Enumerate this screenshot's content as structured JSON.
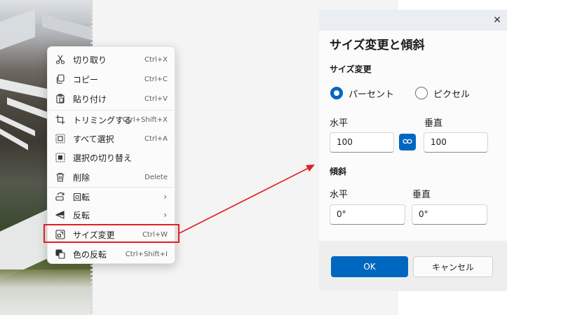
{
  "menu": {
    "items": [
      {
        "label": "切り取り",
        "shortcut": "Ctrl+X",
        "icon": "scissors-icon"
      },
      {
        "label": "コピー",
        "shortcut": "Ctrl+C",
        "icon": "copy-icon"
      },
      {
        "label": "貼り付け",
        "shortcut": "Ctrl+V",
        "icon": "paste-icon"
      },
      {
        "label": "トリミングする",
        "shortcut": "Ctrl+Shift+X",
        "icon": "crop-icon"
      },
      {
        "label": "すべて選択",
        "shortcut": "Ctrl+A",
        "icon": "select-all-icon"
      },
      {
        "label": "選択の切り替え",
        "shortcut": "",
        "icon": "invert-selection-icon"
      },
      {
        "label": "削除",
        "shortcut": "Delete",
        "icon": "trash-icon"
      },
      {
        "label": "回転",
        "shortcut": "",
        "icon": "rotate-icon",
        "submenu": "›"
      },
      {
        "label": "反転",
        "shortcut": "",
        "icon": "flip-icon",
        "submenu": "›"
      },
      {
        "label": "サイズ変更",
        "shortcut": "Ctrl+W",
        "icon": "resize-icon"
      },
      {
        "label": "色の反転",
        "shortcut": "Ctrl+Shift+I",
        "icon": "invert-colors-icon"
      }
    ]
  },
  "dialog": {
    "title": "サイズ変更と傾斜",
    "close_glyph": "✕",
    "resize": {
      "heading": "サイズ変更",
      "option_percent": "パーセント",
      "option_pixel": "ピクセル",
      "selected": "パーセント",
      "horizontal_label": "水平",
      "vertical_label": "垂直",
      "horizontal_value": "100",
      "vertical_value": "100",
      "aspect_lock": "on"
    },
    "skew": {
      "heading": "傾斜",
      "horizontal_label": "水平",
      "vertical_label": "垂直",
      "horizontal_value": "0°",
      "vertical_value": "0°"
    },
    "ok_label": "OK",
    "cancel_label": "キャンセル"
  },
  "colors": {
    "accent": "#0067c0",
    "highlight_box": "#e01f26",
    "arrow": "#e01f26"
  }
}
